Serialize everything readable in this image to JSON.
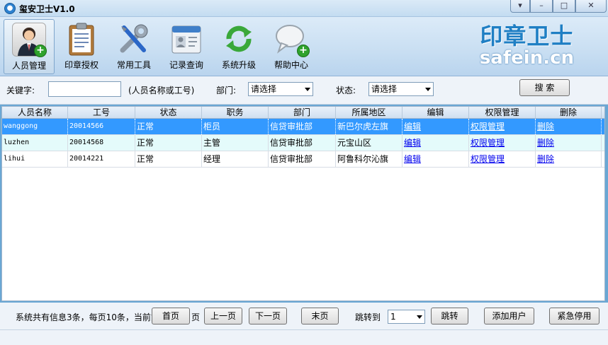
{
  "window": {
    "title": "玺安卫士V1.0",
    "controls": [
      "▾",
      "–",
      "□",
      "✕"
    ]
  },
  "toolbar": {
    "items": [
      {
        "label": "人员管理",
        "icon": "user-manage-icon",
        "active": true
      },
      {
        "label": "印章授权",
        "icon": "clipboard-icon"
      },
      {
        "label": "常用工具",
        "icon": "tools-icon"
      },
      {
        "label": "记录查询",
        "icon": "id-card-icon"
      },
      {
        "label": "系统升级",
        "icon": "refresh-icon"
      },
      {
        "label": "帮助中心",
        "icon": "chat-bubble-icon"
      }
    ],
    "logo_cn": "印章卫士",
    "logo_en": "safein.cn"
  },
  "filters": {
    "keyword_label": "关键字:",
    "keyword_value": "",
    "keyword_hint": "(人员名称或工号)",
    "dept_label": "部门:",
    "dept_value": "请选择",
    "status_label": "状态:",
    "status_value": "请选择",
    "search_label": "搜 索"
  },
  "table": {
    "columns": [
      "人员名称",
      "工号",
      "状态",
      "职务",
      "部门",
      "所属地区",
      "编辑",
      "权限管理",
      "删除"
    ],
    "rows": [
      {
        "name": "wanggong",
        "id": "20014566",
        "status": "正常",
        "role": "柜员",
        "dept": "信贷审批部",
        "region": "新巴尔虎左旗",
        "edit": "编辑",
        "perm": "权限管理",
        "del": "删除"
      },
      {
        "name": "luzhen",
        "id": "20014568",
        "status": "正常",
        "role": "主管",
        "dept": "信贷审批部",
        "region": "元宝山区",
        "edit": "编辑",
        "perm": "权限管理",
        "del": "删除"
      },
      {
        "name": "lihui",
        "id": "20014221",
        "status": "正常",
        "role": "经理",
        "dept": "信贷审批部",
        "region": "阿鲁科尔沁旗",
        "edit": "编辑",
        "perm": "权限管理",
        "del": "删除"
      }
    ]
  },
  "footer": {
    "summary": "系统共有信息3条，每页10条，当前第1页",
    "page_suffix": "页",
    "first": "首页",
    "prev": "上一页",
    "next": "下一页",
    "last": "末页",
    "jump_label": "跳转到",
    "jump_value": "1",
    "jump_button": "跳转",
    "add_user": "添加用户",
    "emergency_stop": "紧急停用"
  },
  "colors": {
    "selection": "#3399ff",
    "alt_row": "#e4fbfb",
    "logo_blue": "#1f7fc4"
  }
}
